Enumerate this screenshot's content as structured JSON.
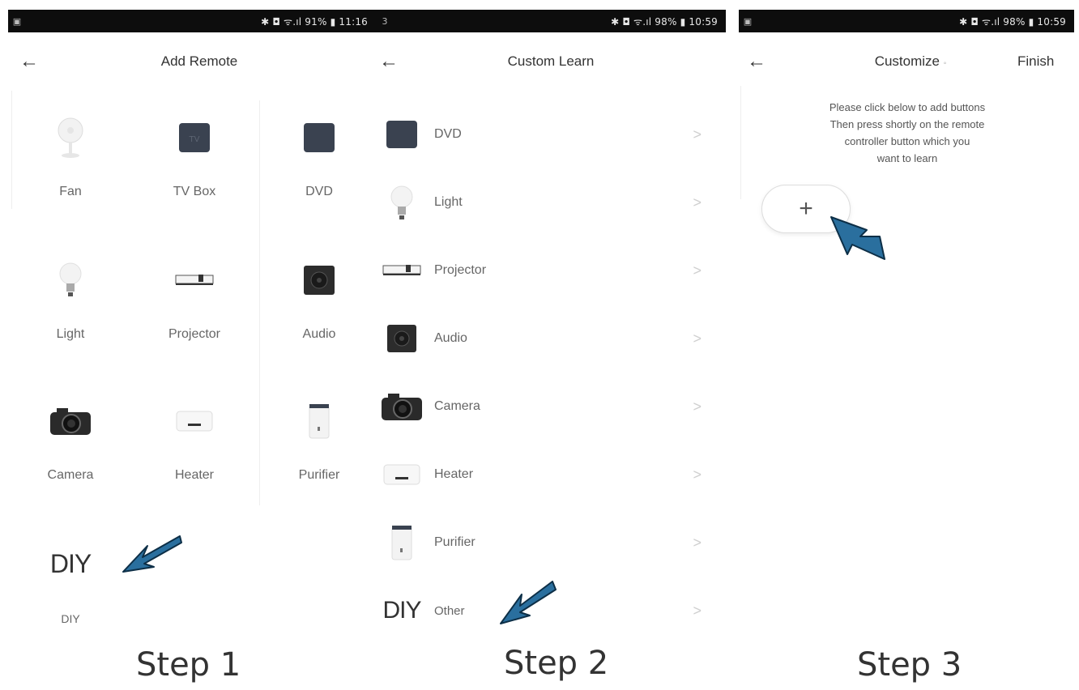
{
  "panel1": {
    "status": {
      "left": "▣",
      "right": "✱ ◘ ᯤ.ıl 91% ▮ 11:16"
    },
    "title": "Add Remote",
    "items": [
      {
        "label": "Fan",
        "icon": "fan-icon"
      },
      {
        "label": "TV Box",
        "icon": "tv-box-icon"
      },
      {
        "label": "DVD",
        "icon": "dvd-icon"
      },
      {
        "label": "Light",
        "icon": "light-bulb-icon"
      },
      {
        "label": "Projector",
        "icon": "projector-icon"
      },
      {
        "label": "Audio",
        "icon": "audio-icon"
      },
      {
        "label": "Camera",
        "icon": "camera-icon"
      },
      {
        "label": "Heater",
        "icon": "heater-icon"
      },
      {
        "label": "Purifier",
        "icon": "purifier-icon"
      }
    ],
    "diy_icon_text": "DIY",
    "diy_label": "DIY",
    "step": "Step 1"
  },
  "panel2": {
    "status": {
      "left": "3",
      "right": "✱ ◘ ᯤ.ıl 98% ▮ 10:59"
    },
    "title": "Custom Learn",
    "items": [
      {
        "label": "DVD",
        "icon": "dvd-icon"
      },
      {
        "label": "Light",
        "icon": "light-bulb-icon"
      },
      {
        "label": "Projector",
        "icon": "projector-icon"
      },
      {
        "label": "Audio",
        "icon": "audio-icon"
      },
      {
        "label": "Camera",
        "icon": "camera-icon"
      },
      {
        "label": "Heater",
        "icon": "heater-icon"
      },
      {
        "label": "Purifier",
        "icon": "purifier-icon"
      },
      {
        "label": "Other",
        "icon": "diy-icon"
      }
    ],
    "diy_icon_text": "DIY",
    "chevron": ">",
    "step": "Step 2"
  },
  "panel3": {
    "status": {
      "left": "▣",
      "right": "✱ ◘ ᯤ.ıl 98% ▮ 10:59"
    },
    "title": "Customize",
    "title_suffix": "◦",
    "finish": "Finish",
    "hint_lines": [
      "Please click below to add buttons",
      "Then press shortly on the remote",
      "controller button which you",
      "want to learn"
    ],
    "add_symbol": "+",
    "step": "Step 3"
  },
  "colors": {
    "arrow": "#2a6f9e",
    "device_dark": "#3a4250"
  }
}
